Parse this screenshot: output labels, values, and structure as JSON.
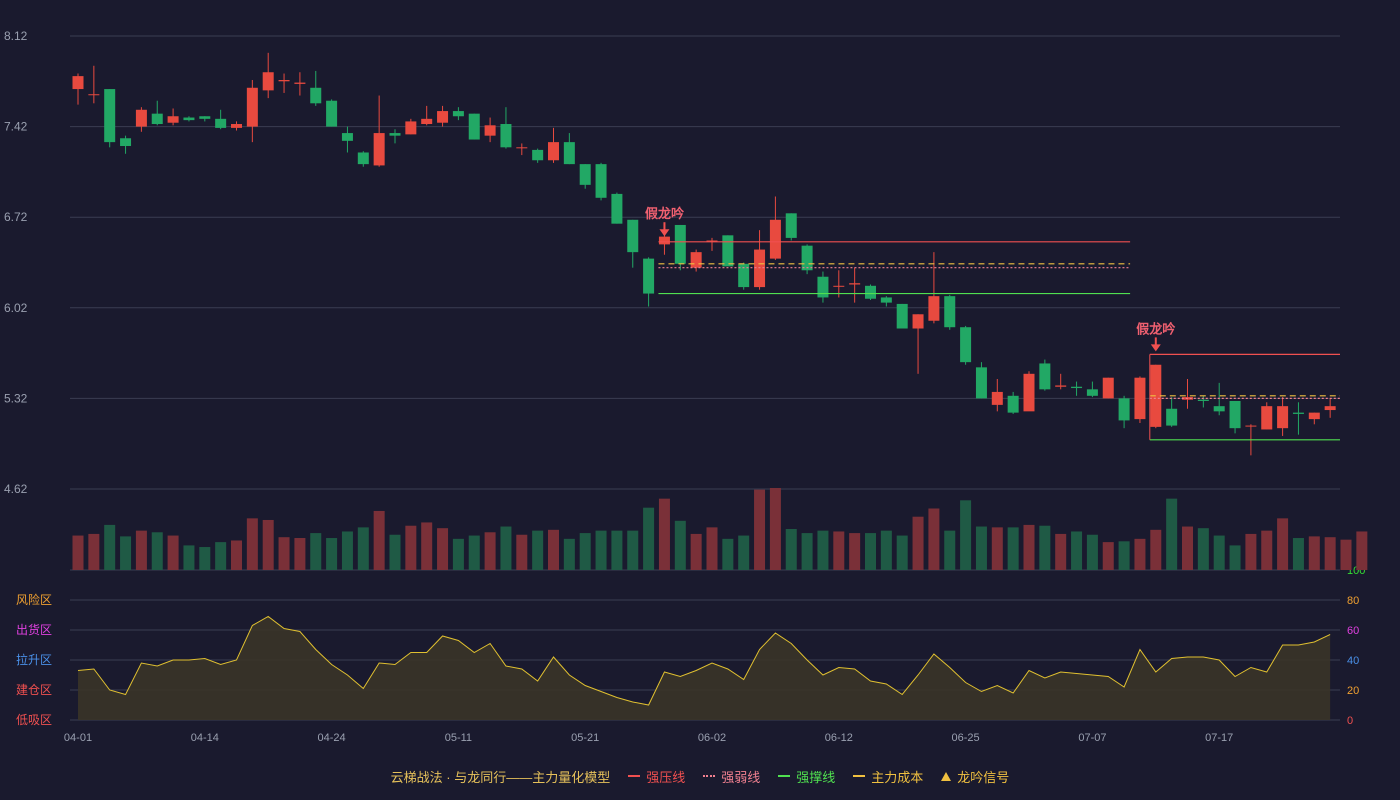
{
  "chart_data": {
    "type": "candlestick",
    "x_ticks": [
      "04-01",
      "04-14",
      "04-24",
      "05-11",
      "05-21",
      "06-02",
      "06-12",
      "06-25",
      "07-07",
      "07-17"
    ],
    "price_ticks": [
      "8.12",
      "7.42",
      "6.72",
      "6.02",
      "5.32",
      "4.62"
    ],
    "ylim": [
      4.62,
      8.12
    ],
    "candles": [
      [
        7.71,
        7.81,
        7.59,
        7.83
      ],
      [
        7.67,
        7.67,
        7.6,
        7.89
      ],
      [
        7.71,
        7.3,
        7.26,
        7.71
      ],
      [
        7.33,
        7.27,
        7.21,
        7.35
      ],
      [
        7.42,
        7.55,
        7.38,
        7.57
      ],
      [
        7.52,
        7.44,
        7.43,
        7.62
      ],
      [
        7.45,
        7.5,
        7.43,
        7.56
      ],
      [
        7.49,
        7.47,
        7.46,
        7.5
      ],
      [
        7.5,
        7.48,
        7.46,
        7.5
      ],
      [
        7.48,
        7.41,
        7.4,
        7.55
      ],
      [
        7.41,
        7.44,
        7.39,
        7.46
      ],
      [
        7.42,
        7.72,
        7.3,
        7.78
      ],
      [
        7.7,
        7.84,
        7.64,
        7.99
      ],
      [
        7.77,
        7.78,
        7.68,
        7.83
      ],
      [
        7.75,
        7.76,
        7.66,
        7.84
      ],
      [
        7.72,
        7.6,
        7.58,
        7.85
      ],
      [
        7.62,
        7.42,
        7.42,
        7.63
      ],
      [
        7.37,
        7.31,
        7.22,
        7.42
      ],
      [
        7.22,
        7.13,
        7.11,
        7.23
      ],
      [
        7.12,
        7.37,
        7.11,
        7.66
      ],
      [
        7.37,
        7.35,
        7.29,
        7.4
      ],
      [
        7.36,
        7.46,
        7.36,
        7.48
      ],
      [
        7.44,
        7.48,
        7.43,
        7.58
      ],
      [
        7.45,
        7.54,
        7.42,
        7.58
      ],
      [
        7.54,
        7.5,
        7.47,
        7.57
      ],
      [
        7.52,
        7.32,
        7.32,
        7.52
      ],
      [
        7.35,
        7.43,
        7.3,
        7.49
      ],
      [
        7.44,
        7.26,
        7.25,
        7.57
      ],
      [
        7.26,
        7.26,
        7.2,
        7.29
      ],
      [
        7.24,
        7.16,
        7.14,
        7.25
      ],
      [
        7.16,
        7.3,
        7.14,
        7.41
      ],
      [
        7.3,
        7.13,
        7.13,
        7.37
      ],
      [
        7.13,
        6.97,
        6.94,
        7.13
      ],
      [
        7.13,
        6.87,
        6.85,
        7.14
      ],
      [
        6.9,
        6.67,
        6.67,
        6.91
      ],
      [
        6.7,
        6.45,
        6.33,
        6.7
      ],
      [
        6.4,
        6.13,
        6.03,
        6.41
      ],
      [
        6.51,
        6.57,
        6.43,
        6.61
      ],
      [
        6.66,
        6.36,
        6.31,
        6.66
      ],
      [
        6.33,
        6.45,
        6.3,
        6.47
      ],
      [
        6.53,
        6.54,
        6.46,
        6.56
      ],
      [
        6.58,
        6.34,
        6.37,
        6.58
      ],
      [
        6.36,
        6.18,
        6.16,
        6.37
      ],
      [
        6.18,
        6.47,
        6.16,
        6.62
      ],
      [
        6.4,
        6.7,
        6.39,
        6.88
      ],
      [
        6.75,
        6.56,
        6.54,
        6.75
      ],
      [
        6.5,
        6.31,
        6.28,
        6.51
      ],
      [
        6.26,
        6.1,
        6.06,
        6.3
      ],
      [
        6.19,
        6.19,
        6.1,
        6.31
      ],
      [
        6.2,
        6.21,
        6.06,
        6.33
      ],
      [
        6.19,
        6.09,
        6.08,
        6.2
      ],
      [
        6.1,
        6.06,
        6.03,
        6.11
      ],
      [
        6.05,
        5.86,
        5.86,
        6.05
      ],
      [
        5.86,
        5.97,
        5.51,
        5.97
      ],
      [
        5.92,
        6.11,
        5.9,
        6.45
      ],
      [
        6.11,
        5.87,
        5.85,
        6.12
      ],
      [
        5.87,
        5.6,
        5.58,
        5.88
      ],
      [
        5.56,
        5.32,
        5.32,
        5.6
      ],
      [
        5.27,
        5.37,
        5.22,
        5.47
      ],
      [
        5.34,
        5.21,
        5.2,
        5.37
      ],
      [
        5.22,
        5.51,
        5.23,
        5.53
      ],
      [
        5.59,
        5.39,
        5.38,
        5.62
      ],
      [
        5.41,
        5.42,
        5.39,
        5.51
      ],
      [
        5.41,
        5.4,
        5.34,
        5.45
      ],
      [
        5.39,
        5.34,
        5.33,
        5.45
      ],
      [
        5.32,
        5.48,
        5.32,
        5.48
      ],
      [
        5.32,
        5.15,
        5.09,
        5.34
      ],
      [
        5.16,
        5.48,
        5.13,
        5.49
      ],
      [
        5.1,
        5.58,
        5.09,
        5.58
      ],
      [
        5.24,
        5.11,
        5.1,
        5.33
      ],
      [
        5.31,
        5.33,
        5.24,
        5.47
      ],
      [
        5.31,
        5.3,
        5.25,
        5.34
      ],
      [
        5.26,
        5.22,
        5.19,
        5.44
      ],
      [
        5.3,
        5.09,
        5.05,
        5.3
      ],
      [
        5.11,
        5.11,
        4.88,
        5.12
      ],
      [
        5.08,
        5.26,
        5.08,
        5.29
      ],
      [
        5.09,
        5.26,
        5.03,
        5.33
      ],
      [
        5.21,
        5.2,
        5.04,
        5.29
      ],
      [
        5.16,
        5.21,
        5.12,
        5.21
      ],
      [
        5.23,
        5.26,
        5.17,
        5.32
      ]
    ],
    "volume": [
      42,
      44,
      55,
      41,
      48,
      46,
      42,
      30,
      28,
      34,
      36,
      63,
      61,
      40,
      39,
      45,
      39,
      47,
      52,
      72,
      43,
      54,
      58,
      51,
      38,
      42,
      46,
      53,
      43,
      48,
      49,
      38,
      45,
      48,
      48,
      48,
      76,
      87,
      60,
      44,
      52,
      38,
      42,
      98,
      100,
      50,
      45,
      48,
      47,
      45,
      45,
      48,
      42,
      65,
      75,
      48,
      85,
      53,
      52,
      52,
      55,
      54,
      44,
      47,
      43,
      34,
      35,
      38,
      49,
      87,
      53,
      51,
      42,
      30,
      44,
      48,
      63,
      39,
      41,
      40,
      37,
      47
    ],
    "oscillator": [
      33,
      34,
      20,
      17,
      38,
      36,
      40,
      40,
      41,
      37,
      40,
      63,
      69,
      61,
      59,
      47,
      37,
      30,
      21,
      38,
      37,
      45,
      45,
      56,
      53,
      45,
      51,
      36,
      34,
      26,
      42,
      30,
      23,
      19,
      15,
      12,
      10,
      32,
      29,
      33,
      38,
      34,
      27,
      47,
      58,
      51,
      40,
      30,
      35,
      34,
      26,
      24,
      17,
      30,
      44,
      35,
      25,
      19,
      23,
      18,
      33,
      28,
      32,
      31,
      30,
      29,
      22,
      47,
      32,
      41,
      42,
      42,
      40,
      29,
      35,
      32,
      50,
      50,
      52,
      57
    ],
    "oscillator_ticks": [
      "100",
      "80",
      "60",
      "40",
      "20",
      "0"
    ],
    "oscillator_ylim": [
      0,
      100
    ],
    "zones": [
      "风险区",
      "出货区",
      "拉升区",
      "建仓区",
      "低吸区"
    ],
    "zone_colors": [
      "#f0a030",
      "#e040e0",
      "#4a90e8",
      "#f05050",
      "#f05050"
    ],
    "osc_tick_colors": [
      "#33dd33",
      "#f0a030",
      "#e040e0",
      "#4a90e8",
      "#f0a030",
      "#f05050"
    ],
    "annotations": [
      {
        "label": "假龙吟",
        "index": 37,
        "price": 6.55
      },
      {
        "label": "假龙吟",
        "index": 68,
        "price": 5.66
      }
    ],
    "levels": [
      {
        "type": "strong_resistance",
        "from": 37,
        "to": 66,
        "value": 6.53,
        "color": "#f05050"
      },
      {
        "type": "strong_weak",
        "from": 37,
        "to": 66,
        "value": 6.33,
        "color": "#f08090"
      },
      {
        "type": "main_cost",
        "from": 37,
        "to": 66,
        "value": 6.36,
        "color": "#f0c040"
      },
      {
        "type": "strong_support",
        "from": 37,
        "to": 66,
        "value": 6.13,
        "color": "#50e050"
      },
      {
        "type": "strong_resistance",
        "from": 68,
        "to": 81,
        "value": 5.66,
        "color": "#f05050"
      },
      {
        "type": "strong_weak",
        "from": 68,
        "to": 81,
        "value": 5.32,
        "color": "#f08090"
      },
      {
        "type": "main_cost",
        "from": 68,
        "to": 81,
        "value": 5.34,
        "color": "#f0c040"
      },
      {
        "type": "strong_support",
        "from": 68,
        "to": 81,
        "value": 5.0,
        "color": "#50e050"
      }
    ],
    "colors": {
      "up": "#e84a3f",
      "down": "#22a865",
      "volume_up": "#7a3038",
      "volume_down": "#1f5a45",
      "oscillator": "#e0c030",
      "grid": "#3a3d52",
      "axis_text": "#9aa0b0"
    }
  },
  "legend": {
    "title": "云梯战法 · 与龙同行——主力量化模型",
    "items": [
      {
        "label": "强压线",
        "color": "#f05050"
      },
      {
        "label": "强弱线",
        "color": "#f08090"
      },
      {
        "label": "强撑线",
        "color": "#50e050"
      },
      {
        "label": "主力成本",
        "color": "#f0c040"
      },
      {
        "label": "龙吟信号",
        "color": "#f0c040"
      }
    ]
  }
}
